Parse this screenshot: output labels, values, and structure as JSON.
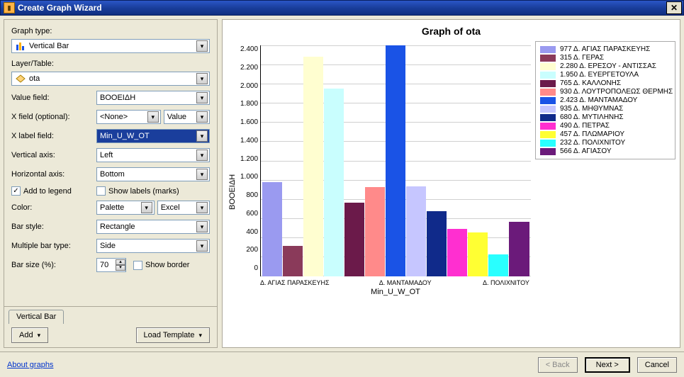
{
  "window": {
    "title": "Create Graph Wizard"
  },
  "form": {
    "graph_type_label": "Graph type:",
    "graph_type_value": "Vertical Bar",
    "layer_label": "Layer/Table:",
    "layer_value": "ota",
    "value_field_label": "Value field:",
    "value_field_value": "ΒΟΟΕΙΔΗ",
    "x_field_label": "X field (optional):",
    "x_field_value": "<None>",
    "x_field_value2": "Value",
    "x_label_field_label": "X label field:",
    "x_label_field_value": "Min_U_W_OT",
    "vertical_axis_label": "Vertical axis:",
    "vertical_axis_value": "Left",
    "horizontal_axis_label": "Horizontal axis:",
    "horizontal_axis_value": "Bottom",
    "add_legend": "Add to legend",
    "show_labels": "Show labels (marks)",
    "color_label": "Color:",
    "color_value": "Palette",
    "color_value2": "Excel",
    "bar_style_label": "Bar style:",
    "bar_style_value": "Rectangle",
    "multi_bar_label": "Multiple bar type:",
    "multi_bar_value": "Side",
    "bar_size_label": "Bar size (%):",
    "bar_size_value": "70",
    "show_border": "Show border",
    "tab_label": "Vertical Bar",
    "add_btn": "Add",
    "load_template_btn": "Load Template"
  },
  "footer": {
    "about": "About graphs",
    "back": "< Back",
    "next": "Next >",
    "cancel": "Cancel"
  },
  "chart_data": {
    "type": "bar",
    "title": "Graph of ota",
    "ylabel": "ΒΟΟΕΙΔΗ",
    "xlabel": "Min_U_W_OT",
    "ylim": [
      0,
      2400
    ],
    "yticks": [
      "2.400",
      "2.200",
      "2.000",
      "1.800",
      "1.600",
      "1.400",
      "1.200",
      "1.000",
      "800",
      "600",
      "400",
      "200",
      "0"
    ],
    "x_tick_labels": [
      "Δ. ΑΓΙΑΣ ΠΑΡΑΣΚΕΥΗΣ",
      "",
      "Δ. ΜΑΝΤΑΜΑΔΟΥ",
      "",
      "Δ. ΠΟΛΙΧΝΙΤΟΥ"
    ],
    "series": [
      {
        "name": "Δ. ΑΓΙΑΣ ΠΑΡΑΣΚΕΥΗΣ",
        "value": 977,
        "legend": "977 Δ. ΑΓΙΑΣ ΠΑΡΑΣΚΕΥΗΣ",
        "color": "#9a9af0"
      },
      {
        "name": "Δ. ΓΕΡΑΣ",
        "value": 315,
        "legend": "315 Δ. ΓΕΡΑΣ",
        "color": "#8a3a5a"
      },
      {
        "name": "Δ. ΕΡΕΣΟΥ - ΑΝΤΙΣΣΑΣ",
        "value": 2280,
        "legend": "2.280 Δ. ΕΡΕΣΟΥ - ΑΝΤΙΣΣΑΣ",
        "color": "#fffed0"
      },
      {
        "name": "Δ. ΕΥΕΡΓΕΤΟΥΛΑ",
        "value": 1950,
        "legend": "1.950 Δ. ΕΥΕΡΓΕΤΟΥΛΑ",
        "color": "#c9fefe"
      },
      {
        "name": "Δ. ΚΑΛΛΟΝΗΣ",
        "value": 765,
        "legend": "765 Δ. ΚΑΛΛΟΝΗΣ",
        "color": "#6b1a4a"
      },
      {
        "name": "Δ. ΛΟΥΤΡΟΠΟΛΕΩΣ ΘΕΡΜΗΣ",
        "value": 930,
        "legend": "930 Δ. ΛΟΥΤΡΟΠΟΛΕΩΣ ΘΕΡΜΗΣ",
        "color": "#ff8a8a"
      },
      {
        "name": "Δ. ΜΑΝΤΑΜΑΔΟΥ",
        "value": 2423,
        "legend": "2.423 Δ. ΜΑΝΤΑΜΑΔΟΥ",
        "color": "#1a53e6"
      },
      {
        "name": "Δ. ΜΗΘΥΜΝΑΣ",
        "value": 935,
        "legend": "935 Δ. ΜΗΘΥΜΝΑΣ",
        "color": "#c6c6ff"
      },
      {
        "name": "Δ. ΜΥΤΙΛΗΝΗΣ",
        "value": 680,
        "legend": "680 Δ. ΜΥΤΙΛΗΝΗΣ",
        "color": "#102a8a"
      },
      {
        "name": "Δ. ΠΕΤΡΑΣ",
        "value": 490,
        "legend": "490 Δ. ΠΕΤΡΑΣ",
        "color": "#ff2fd0"
      },
      {
        "name": "Δ. ΠΛΩΜΑΡΙΟΥ",
        "value": 457,
        "legend": "457 Δ. ΠΛΩΜΑΡΙΟΥ",
        "color": "#ffff33"
      },
      {
        "name": "Δ. ΠΟΛΙΧΝΙΤΟΥ",
        "value": 232,
        "legend": "232 Δ. ΠΟΛΙΧΝΙΤΟΥ",
        "color": "#29ffff"
      },
      {
        "name": "Δ. ΑΓΙΑΣΟΥ",
        "value": 566,
        "legend": "566 Δ. ΑΓΙΑΣΟΥ",
        "color": "#6b1a7a"
      }
    ]
  }
}
